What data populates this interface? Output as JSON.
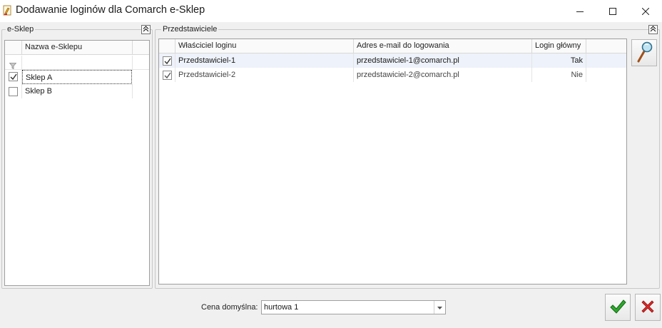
{
  "window": {
    "title": "Dodawanie loginów dla Comarch e-Sklep",
    "minimize_icon": "minimize-icon",
    "maximize_icon": "maximize-icon",
    "close_icon": "close-icon"
  },
  "eshop_group": {
    "label": "e-Sklep",
    "columns": [
      "Nazwa e-Sklepu"
    ],
    "rows": [
      {
        "checked": true,
        "name": "Sklep A"
      },
      {
        "checked": false,
        "name": "Sklep B"
      }
    ]
  },
  "reps_group": {
    "label": "Przedstawiciele",
    "columns": [
      "Właściciel loginu",
      "Adres e-mail do logowania",
      "Login główny"
    ],
    "rows": [
      {
        "checked": true,
        "owner": "Przedstawiciel-1",
        "email": "przedstawiciel-1@comarch.pl",
        "main": "Tak"
      },
      {
        "checked": true,
        "owner": "Przedstawiciel-2",
        "email": "przedstawiciel-2@comarch.pl",
        "main": "Nie"
      }
    ]
  },
  "footer": {
    "price_label": "Cena domyślna:",
    "price_value": "hurtowa 1"
  },
  "colors": {
    "accept": "#1e9a1e",
    "cancel": "#d42020"
  }
}
